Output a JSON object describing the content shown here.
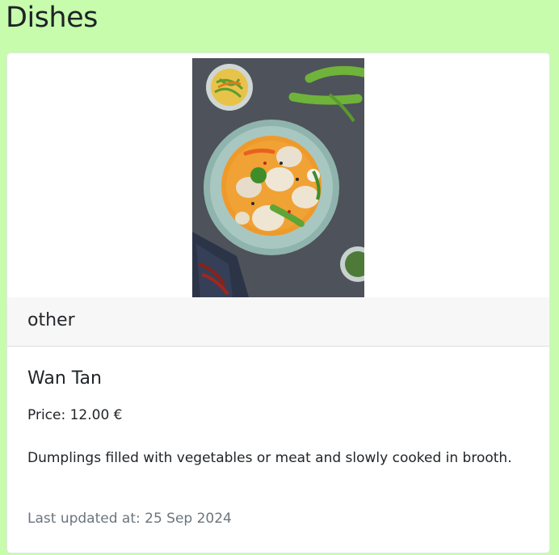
{
  "page": {
    "title": "Dishes"
  },
  "dish": {
    "category": "other",
    "name": "Wan Tan",
    "price_label": "Price:",
    "price": "12.00 €",
    "description": "Dumplings filled with vegetables or meat and slowly cooked in brooth.",
    "updated_label": "Last updated at:",
    "updated": "25 Sep 2024",
    "image_icon": "dumpling-soup-photo"
  },
  "colors": {
    "page_bg": "#c6fcac",
    "card_bg": "#ffffff",
    "header_bg": "#f7f7f7",
    "muted_text": "#6c757d"
  }
}
